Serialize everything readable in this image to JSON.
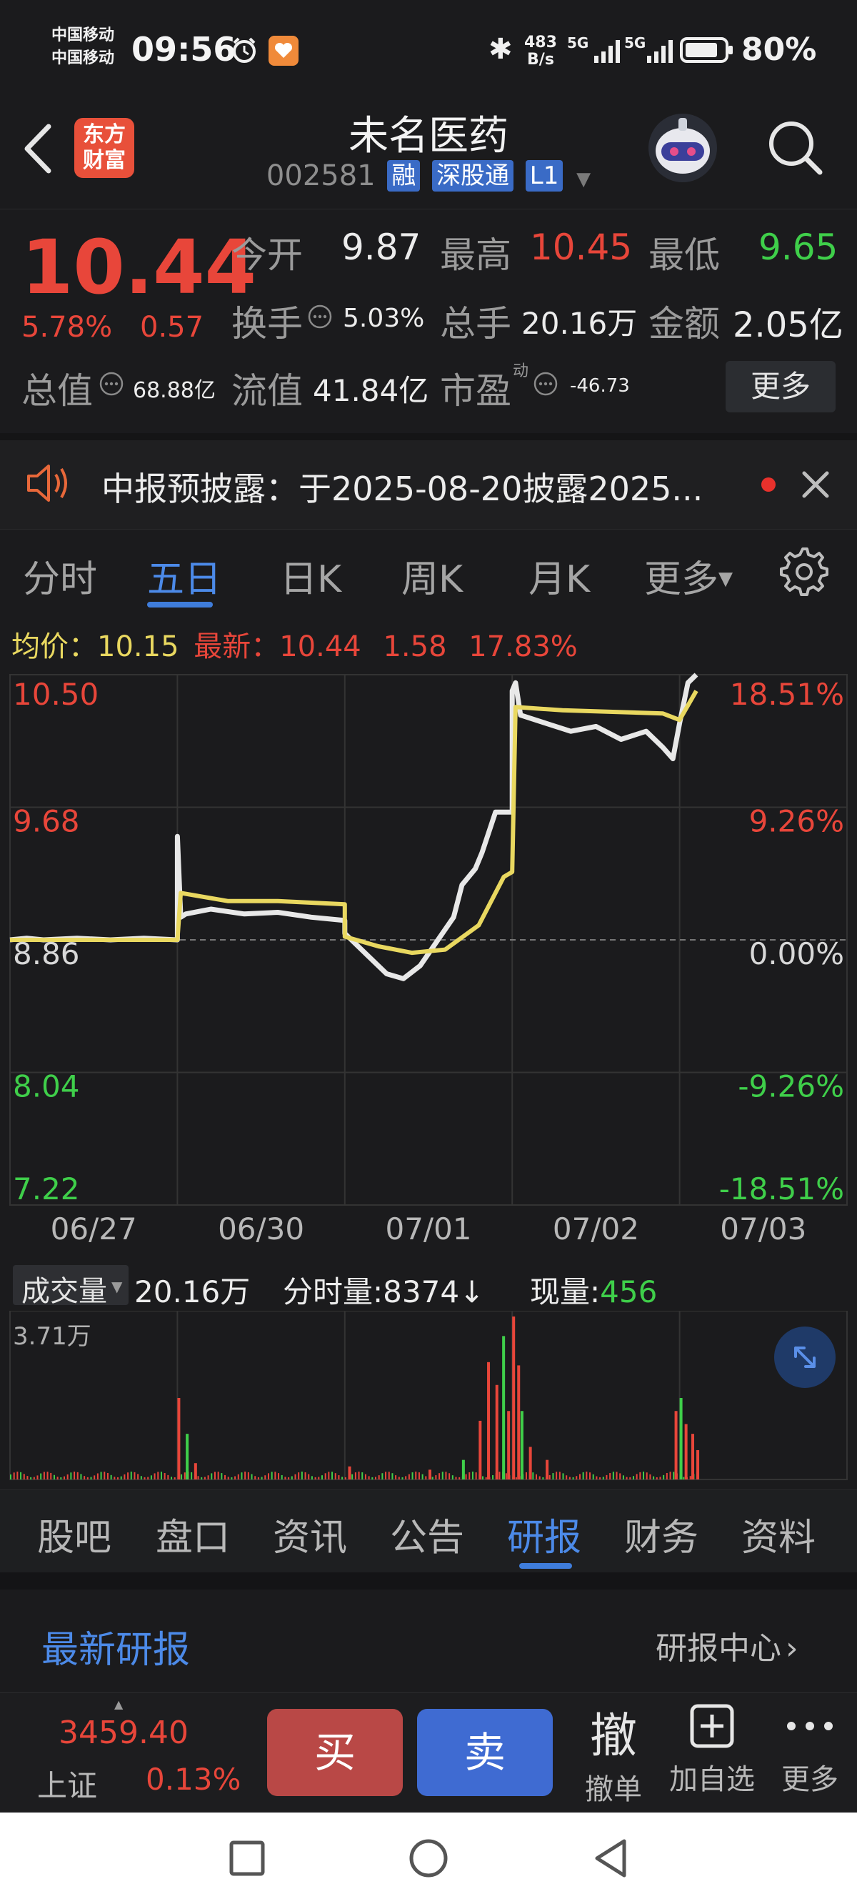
{
  "status_bar": {
    "carrier1": "中国移动",
    "carrier2": "中国移动",
    "time": "09:56",
    "net_speed_top": "483",
    "net_speed_bottom": "B/s",
    "signal1": "5G",
    "signal2": "5G",
    "battery": "80%"
  },
  "header": {
    "logo_line1": "东方",
    "logo_line2": "财富",
    "title": "未名医药",
    "code": "002581",
    "tags": [
      "融",
      "深股通",
      "L1"
    ]
  },
  "quote": {
    "price": "10.44",
    "change_pct": "5.78%",
    "change_abs": "0.57",
    "open_label": "今开",
    "open_value": "9.87",
    "high_label": "最高",
    "high_value": "10.45",
    "low_label": "最低",
    "low_value": "9.65",
    "turnover_label": "换手",
    "turnover_value": "5.03%",
    "volume_label": "总手",
    "volume_value": "20.16万",
    "amount_label": "金额",
    "amount_value": "2.05亿",
    "mktcap_label": "总值",
    "mktcap_value": "68.88亿",
    "float_label": "流值",
    "float_value": "41.84亿",
    "pe_label": "市盈",
    "pe_sup": "动",
    "pe_value": "-46.73",
    "more_label": "更多"
  },
  "announcement": {
    "text": "中报预披露：于2025-08-20披露2025..."
  },
  "chart_tabs": {
    "items": [
      "分时",
      "五日",
      "日K",
      "周K",
      "月K",
      "更多"
    ],
    "active": "五日"
  },
  "avg_row": {
    "avg_label": "均价：",
    "avg_value": "10.15",
    "latest_label": "最新：",
    "latest_value": "10.44",
    "latest_change": "1.58",
    "latest_pct": "17.83%"
  },
  "chart_data": {
    "type": "line",
    "x_labels": [
      "06/27",
      "06/30",
      "07/01",
      "07/02",
      "07/03"
    ],
    "y_left_ticks": [
      "10.50",
      "9.68",
      "8.86",
      "8.04",
      "7.22"
    ],
    "y_right_ticks": [
      "18.51%",
      "9.26%",
      "0.00%",
      "-9.26%",
      "-18.51%"
    ],
    "ylim": [
      7.22,
      10.5
    ],
    "base_price": 8.86,
    "series": [
      {
        "color": "#e8e8e8",
        "x": [
          0,
          0.1,
          0.2,
          0.4,
          0.6,
          0.8,
          1.0,
          1.0,
          1.02,
          1.05,
          1.2,
          1.4,
          1.6,
          1.8,
          2.0,
          2.0,
          2.1,
          2.25,
          2.35,
          2.45,
          2.55,
          2.65,
          2.7,
          2.78,
          2.82,
          2.9,
          3.0,
          3.0,
          3.02,
          3.05,
          3.2,
          3.35,
          3.5,
          3.65,
          3.8,
          3.9,
          3.96,
          4.0,
          4.05,
          4.1
        ],
        "y": [
          8.86,
          8.87,
          8.86,
          8.87,
          8.86,
          8.87,
          8.86,
          9.5,
          9.0,
          9.02,
          9.05,
          9.02,
          9.03,
          9.0,
          8.98,
          8.9,
          8.8,
          8.65,
          8.62,
          8.7,
          8.85,
          9.0,
          9.2,
          9.3,
          9.4,
          9.65,
          9.65,
          10.4,
          10.45,
          10.25,
          10.2,
          10.15,
          10.18,
          10.1,
          10.15,
          10.05,
          9.98,
          10.2,
          10.45,
          10.5
        ]
      },
      {
        "color": "#e9d860",
        "x": [
          0,
          0.5,
          1.0,
          1.02,
          1.3,
          1.6,
          2.0,
          2.0,
          2.2,
          2.4,
          2.6,
          2.8,
          2.95,
          3.0,
          3.02,
          3.3,
          3.6,
          3.9,
          4.0,
          4.1
        ],
        "y": [
          8.86,
          8.86,
          8.86,
          9.15,
          9.1,
          9.1,
          9.08,
          8.88,
          8.82,
          8.78,
          8.8,
          8.95,
          9.25,
          9.28,
          10.3,
          10.28,
          10.27,
          10.26,
          10.22,
          10.4
        ]
      }
    ]
  },
  "volume": {
    "label": "成交量",
    "total": "20.16万",
    "period_label": "分时量:",
    "period_value": "8374",
    "period_arrow": "↓",
    "current_label": "现量:",
    "current_value": "456",
    "max_label": "3.71万",
    "bars_x": [
      1.0,
      1.05,
      1.1,
      2.02,
      2.5,
      2.7,
      2.8,
      2.85,
      2.9,
      2.94,
      2.97,
      3.0,
      3.03,
      3.05,
      3.1,
      3.2,
      3.97,
      4.0,
      4.03,
      4.07,
      4.1
    ],
    "bars_v": [
      0.5,
      0.28,
      0.1,
      0.08,
      0.06,
      0.12,
      0.36,
      0.72,
      0.58,
      0.88,
      0.42,
      1.0,
      0.7,
      0.42,
      0.2,
      0.12,
      0.42,
      0.5,
      0.34,
      0.28,
      0.18
    ]
  },
  "bottom_tabs": {
    "items": [
      "股吧",
      "盘口",
      "资讯",
      "公告",
      "研报",
      "财务",
      "资料"
    ],
    "active": "研报"
  },
  "research": {
    "title": "最新研报",
    "center_label": "研报中心"
  },
  "trade_bar": {
    "index_value": "3459.40",
    "index_name": "上证",
    "index_pct": "0.13%",
    "buy_label": "买",
    "sell_label": "卖",
    "cancel_icon": "撤",
    "cancel_label": "撤单",
    "add_label": "加自选",
    "more_label": "更多"
  }
}
